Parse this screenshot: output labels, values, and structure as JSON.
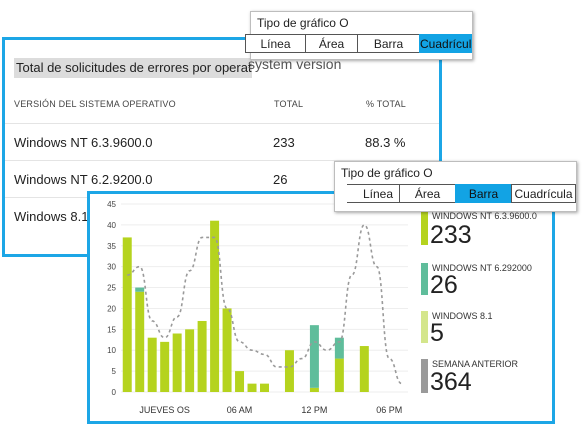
{
  "table_panel": {
    "title": "Total de solicitudes de errores por operativo",
    "title_ghost": "system version",
    "headers": [
      "VERSIÓN DEL SISTEMA OPERATIVO",
      "TOTAL",
      "% TOTAL"
    ],
    "rows": [
      {
        "name": "Windows NT 6.3.9600.0",
        "total": "233",
        "pct": "88.3 %"
      },
      {
        "name": "Windows NT 6.2.9200.0",
        "total": "26",
        "pct": ""
      },
      {
        "name": "Windows 8.1",
        "total": "",
        "pct": ""
      }
    ]
  },
  "chart_type_top": {
    "label": "Tipo de gráfico O",
    "options": [
      "Línea",
      "Área",
      "Barra",
      "Cuadrícula"
    ],
    "active": "Cuadrícula"
  },
  "chart_type_front": {
    "label": "Tipo de gráfico O",
    "options": [
      "Línea",
      "Área",
      "Barra",
      "Cuadrícula"
    ],
    "active": "Barra"
  },
  "legend": [
    {
      "name": "WINDOWS NT 6.3.9600.0",
      "value": "233",
      "color": "#b5d31e"
    },
    {
      "name": "WINDOWS NT 6.292000",
      "value": "26",
      "color": "#5fbd9b"
    },
    {
      "name": "WINDOWS 8.1",
      "value": "5",
      "color": "#d4e68c"
    },
    {
      "name": "SEMANA ANTERIOR",
      "value": "364",
      "color": "#9a9a9a"
    }
  ],
  "chart_data": {
    "type": "bar",
    "stacked": true,
    "ylim": [
      0,
      45
    ],
    "yticks": [
      0,
      5,
      10,
      15,
      20,
      25,
      30,
      35,
      40,
      45
    ],
    "xtick_labels": [
      {
        "label": "JUEVES OS",
        "at": 3.5
      },
      {
        "label": "06 AM",
        "at": 9.5
      },
      {
        "label": "12 PM",
        "at": 15.5
      },
      {
        "label": "06 PM",
        "at": 21.5
      }
    ],
    "x": [
      0,
      1,
      2,
      3,
      4,
      5,
      6,
      7,
      8,
      9,
      10,
      11,
      12,
      13,
      14,
      15,
      16,
      17,
      18,
      19,
      20,
      21,
      22
    ],
    "series": [
      {
        "name": "WINDOWS NT 6.3.9600.0",
        "color": "#b5d31e",
        "values": [
          37,
          24,
          13,
          12,
          14,
          15,
          17,
          41,
          20,
          5,
          2,
          2,
          0,
          10,
          0,
          1,
          0,
          8,
          0,
          11,
          0,
          0,
          0
        ]
      },
      {
        "name": "WINDOWS NT 6.292000",
        "color": "#5fbd9b",
        "values": [
          0,
          1,
          0,
          0,
          0,
          0,
          0,
          0,
          0,
          0,
          0,
          0,
          0,
          0,
          0,
          15,
          0,
          5,
          0,
          0,
          0,
          0,
          0
        ]
      },
      {
        "name": "WINDOWS 8.1",
        "color": "#d4e68c",
        "values": [
          0,
          0,
          0,
          0,
          0,
          0,
          0,
          0,
          0,
          0,
          0,
          0,
          0,
          0,
          0,
          0,
          0,
          0,
          0,
          0,
          0,
          0,
          0
        ]
      }
    ],
    "previous_week": {
      "name": "SEMANA ANTERIOR",
      "color": "#9a9a9a",
      "values": [
        28,
        30,
        17,
        13,
        18,
        29,
        37,
        37,
        20,
        12,
        10,
        9,
        6,
        6,
        8,
        12,
        10,
        12,
        28,
        40,
        30,
        8,
        2
      ]
    }
  }
}
